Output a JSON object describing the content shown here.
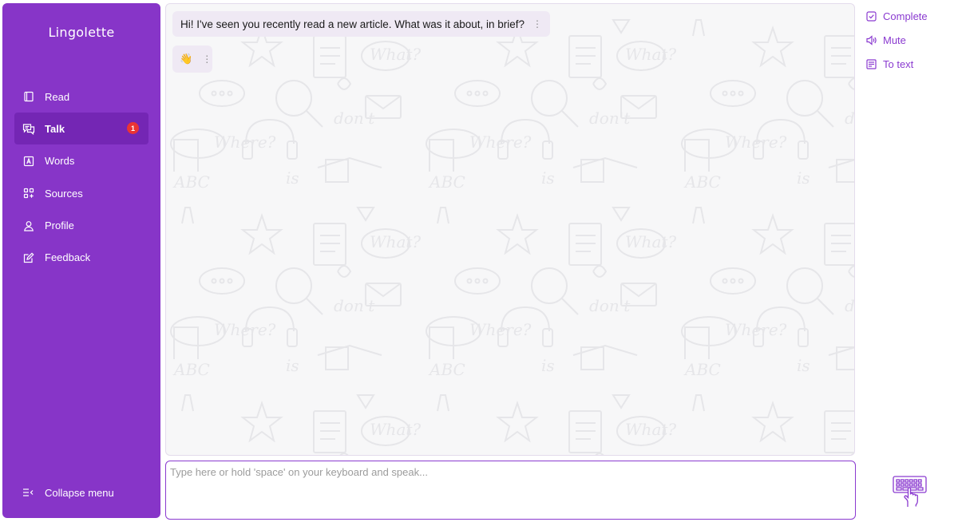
{
  "app": {
    "title": "Lingolette"
  },
  "sidebar": {
    "items": [
      {
        "label": "Read",
        "icon": "book-icon"
      },
      {
        "label": "Talk",
        "icon": "chat-icon",
        "badge": "1",
        "active": true
      },
      {
        "label": "Words",
        "icon": "letter-a-icon"
      },
      {
        "label": "Sources",
        "icon": "grid-plus-icon"
      },
      {
        "label": "Profile",
        "icon": "user-icon"
      },
      {
        "label": "Feedback",
        "icon": "edit-icon"
      }
    ],
    "collapse_label": "Collapse menu"
  },
  "chat": {
    "message": "Hi! I've seen you recently read a new article. What was it about, in brief?",
    "reaction": "👋",
    "more_icon": "⋮"
  },
  "input": {
    "placeholder": "Type here or hold 'space' on your keyboard and speak..."
  },
  "actions": {
    "complete": "Complete",
    "mute": "Mute",
    "to_text": "To text"
  },
  "colors": {
    "accent": "#8735c8",
    "accent_dark": "#7426b4",
    "badge": "#ea3434",
    "bubble": "#efe9f4"
  }
}
